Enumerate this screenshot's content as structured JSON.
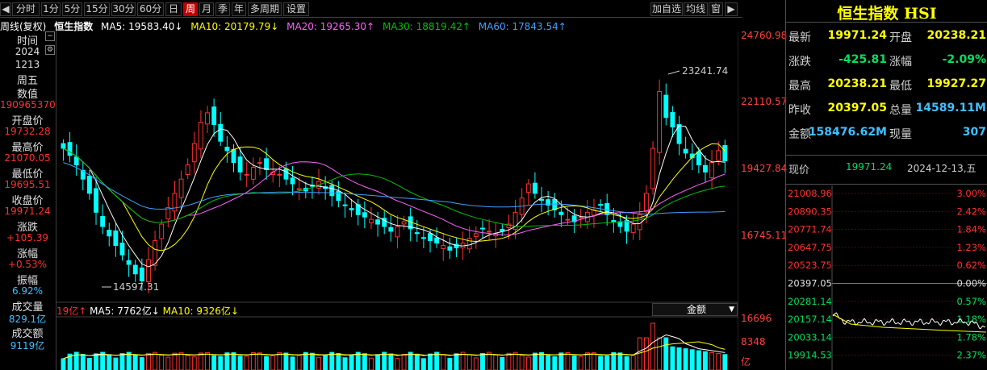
{
  "toolbar": {
    "periods": [
      "分时",
      "1分",
      "5分",
      "15分",
      "30分",
      "60分",
      "日",
      "周",
      "月",
      "季",
      "年",
      "多周期",
      "设置"
    ],
    "active": "周",
    "right_buttons": [
      "加自选",
      "均线",
      "窗"
    ]
  },
  "ma_bar": {
    "mode": "周线(复权)",
    "name": "恒生指数",
    "ma5": "MA5: 19583.40↓",
    "ma10": "MA10: 20179.79↓",
    "ma20": "MA20: 19265.30↑",
    "ma30": "MA30: 18819.42↑",
    "ma60": "MA60: 17843.54↑"
  },
  "left_panel": [
    {
      "label": "时间",
      "value": "2024"
    },
    {
      "label": "",
      "value": "1213"
    },
    {
      "label": "周五",
      "value": ""
    },
    {
      "label": "数值",
      "value": "190965370"
    },
    {
      "label": "开盘价",
      "value": "19732.28"
    },
    {
      "label": "最高价",
      "value": "21070.05"
    },
    {
      "label": "最低价",
      "value": "19695.51"
    },
    {
      "label": "收盘价",
      "value": "19971.24"
    },
    {
      "label": "涨跌",
      "value": "+105.39"
    },
    {
      "label": "涨幅",
      "value": "+0.53%"
    },
    {
      "label": "振幅",
      "value": "6.92%"
    },
    {
      "label": "成交量",
      "value": "829.1亿"
    },
    {
      "label": "成交额",
      "value": "9119亿"
    }
  ],
  "price_axis": [
    "24760.98",
    "22110.57",
    "19427.84",
    "16745.11"
  ],
  "annotations": {
    "high": "23241.74",
    "low": "14597.31"
  },
  "volume_bar": {
    "prefix": "19亿↑",
    "ma5": "MA5: 7762亿↓",
    "ma10": "MA10: 9326亿↓",
    "selector": "金额"
  },
  "volume_axis": [
    "16696",
    "8348",
    "亿"
  ],
  "quote": {
    "title": "恒生指数 HSI",
    "rows": [
      {
        "k1": "最新",
        "v1": "19971.24",
        "k2": "开盘",
        "v2": "20238.21"
      },
      {
        "k1": "涨跌",
        "v1": "-425.81",
        "k2": "涨幅",
        "v2": "-2.09%"
      },
      {
        "k1": "最高",
        "v1": "20238.21",
        "k2": "最低",
        "v2": "19927.27"
      },
      {
        "k1": "昨收",
        "v1": "20397.05",
        "k2": "总量",
        "v2": "14589.11M"
      },
      {
        "k1": "金额",
        "v1": "158476.62M",
        "k2": "现量",
        "v2": "307"
      }
    ],
    "now_label": "现价",
    "now_value": "19971.24",
    "now_date": "2024-12-13,五"
  },
  "intraday": {
    "prices": [
      "21008.96",
      "20890.35",
      "20771.74",
      "20647.75",
      "20523.75",
      "20397.05",
      "20281.14",
      "20157.14",
      "20033.14",
      "19914.53"
    ],
    "pcts": [
      "3.00%",
      "2.42%",
      "1.84%",
      "1.23%",
      "0.62%",
      "0.00%",
      "0.57%",
      "1.18%",
      "1.78%",
      "2.37%"
    ]
  },
  "colors": {
    "up": "#ff3030",
    "down": "#00ffff",
    "ma5": "#ffffff",
    "ma10": "#ffff00",
    "ma20": "#ff60ff",
    "ma30": "#00c000",
    "ma60": "#40a0ff"
  }
}
